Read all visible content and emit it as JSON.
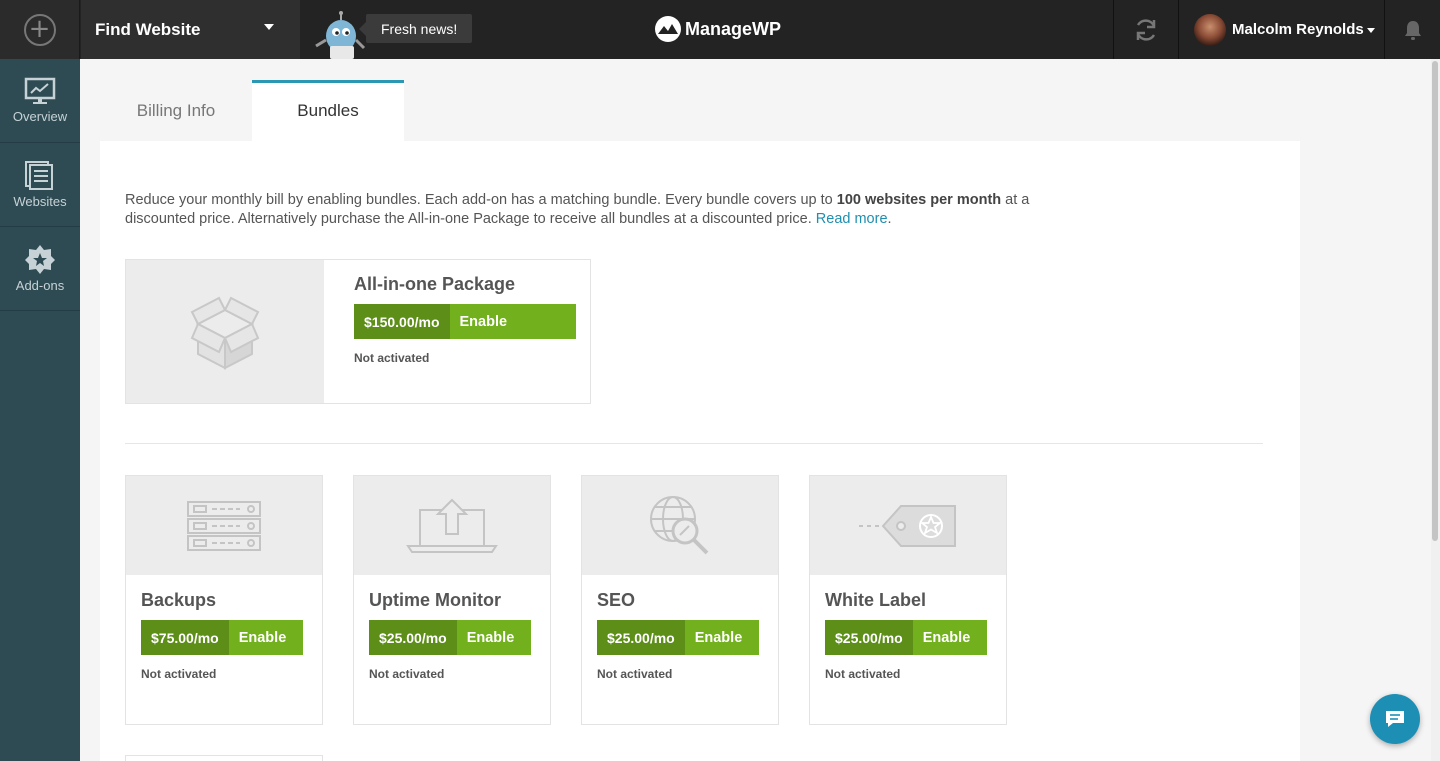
{
  "topbar": {
    "add_icon": "plus-circle-icon",
    "find_website": "Find Website",
    "news": "Fresh news!",
    "logo": "ManageWP",
    "user_name": "Malcolm Reynolds"
  },
  "sidebar": {
    "items": [
      {
        "label": "Overview",
        "icon": "monitor-chart-icon"
      },
      {
        "label": "Websites",
        "icon": "pages-icon"
      },
      {
        "label": "Add-ons",
        "icon": "gear-badge-icon"
      }
    ]
  },
  "tabs": [
    {
      "label": "Billing Info",
      "active": false
    },
    {
      "label": "Bundles",
      "active": true
    }
  ],
  "intro": {
    "part1": "Reduce your monthly bill by enabling bundles. Each add-on has a matching bundle. Every bundle covers up to ",
    "bold": "100 websites per month",
    "part2": " at a discounted price. Alternatively purchase the All-in-one Package to receive all bundles at a discounted price. ",
    "link": "Read more",
    "end": "."
  },
  "all_in_one": {
    "title": "All-in-one Package",
    "price": "$150.00/mo",
    "action": "Enable",
    "status": "Not activated"
  },
  "bundles": [
    {
      "title": "Backups",
      "price": "$75.00/mo",
      "action": "Enable",
      "status": "Not activated",
      "icon": "server-icon"
    },
    {
      "title": "Uptime Monitor",
      "price": "$25.00/mo",
      "action": "Enable",
      "status": "Not activated",
      "icon": "laptop-upload-icon"
    },
    {
      "title": "SEO",
      "price": "$25.00/mo",
      "action": "Enable",
      "status": "Not activated",
      "icon": "globe-search-icon"
    },
    {
      "title": "White Label",
      "price": "$25.00/mo",
      "action": "Enable",
      "status": "Not activated",
      "icon": "tag-star-icon"
    }
  ],
  "colors": {
    "sidebar": "#2e4b54",
    "price_green": "#5c8e18",
    "enable_green": "#72b01d",
    "link": "#1f8fb0"
  }
}
